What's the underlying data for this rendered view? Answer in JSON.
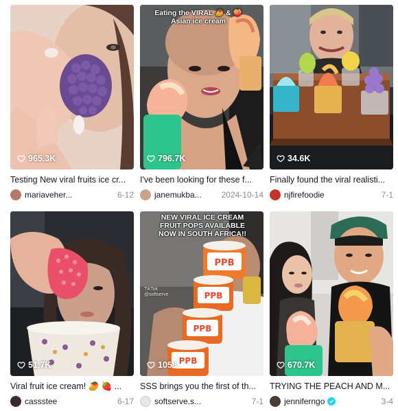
{
  "videos": [
    {
      "views": "965.3K",
      "caption": "Testing New viral fruits ice cr...",
      "username": "mariaveher...",
      "date": "6-12",
      "avatar_color": "#b7796a",
      "overlay": ""
    },
    {
      "views": "796.7K",
      "caption": "I've been looking for these f...",
      "username": "janemukba...",
      "date": "2024-10-14",
      "avatar_color": "#caa48a",
      "overlay": "Eating the VIRAL 🥭 & 🍑 Asian ice cream"
    },
    {
      "views": "34.6K",
      "caption": "Finally found the viral realisti...",
      "username": "njfirefoodie",
      "date": "7-1",
      "avatar_color": "#c8322b",
      "overlay": ""
    },
    {
      "views": "51.7K",
      "caption": "Viral fruit ice cream! 🥭 🍓 ...",
      "username": "cassstee",
      "date": "6-17",
      "avatar_color": "#3a2a33",
      "overlay": ""
    },
    {
      "views": "1058",
      "caption": "SSS brings you the first of th...",
      "username": "softserve.s...",
      "date": "7-1",
      "avatar_color": "#e6e6e6",
      "overlay": "NEW VIRAL ICE CREAM FRUIT POPS AVAILABLE NOW IN SOUTH AFRICA!!",
      "watermark": "TikTok\n@softserve"
    },
    {
      "views": "670.7K",
      "caption": "TRYING THE PEACH AND M...",
      "username": "jenniferngo",
      "date": "3-4",
      "avatar_color": "#4a3a38",
      "verified": true,
      "overlay": ""
    }
  ]
}
